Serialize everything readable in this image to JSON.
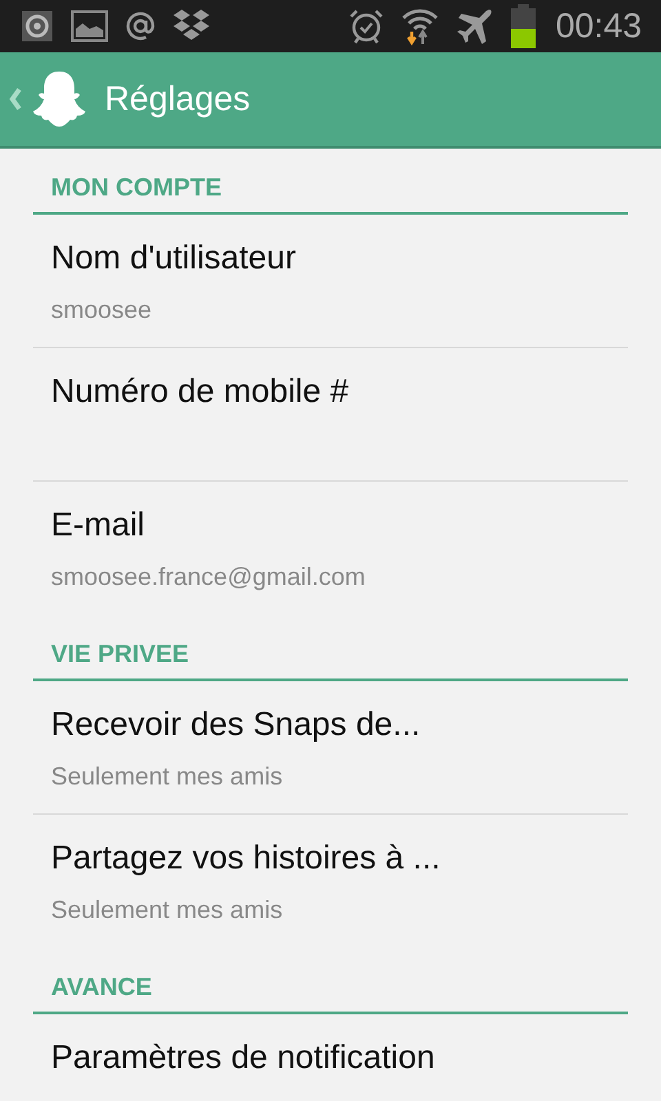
{
  "status_bar": {
    "time": "00:43"
  },
  "header": {
    "title": "Réglages"
  },
  "sections": [
    {
      "title": "MON COMPTE",
      "items": [
        {
          "title": "Nom d'utilisateur",
          "subtitle": "smoosee"
        },
        {
          "title": "Numéro de mobile #"
        },
        {
          "title": "E-mail",
          "subtitle": "smoosee.france@gmail.com"
        }
      ]
    },
    {
      "title": "VIE PRIVEE",
      "items": [
        {
          "title": "Recevoir des Snaps de...",
          "subtitle": "Seulement mes amis"
        },
        {
          "title": "Partagez vos histoires à ...",
          "subtitle": "Seulement mes amis"
        }
      ]
    },
    {
      "title": "AVANCE",
      "items": [
        {
          "title": "Paramètres de notification"
        }
      ]
    }
  ]
}
